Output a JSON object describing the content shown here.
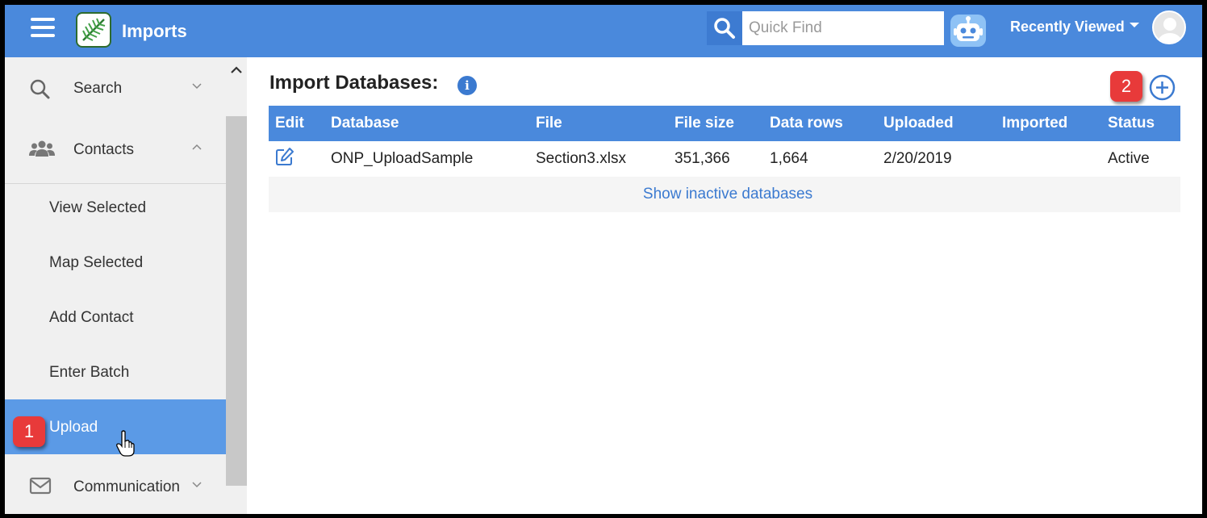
{
  "header": {
    "app_title": "Imports",
    "search_placeholder": "Quick Find",
    "recently_viewed": "Recently Viewed"
  },
  "sidebar": {
    "top_items": [
      {
        "label": "Search",
        "icon": "search-icon"
      },
      {
        "label": "Contacts",
        "icon": "contacts-icon"
      }
    ],
    "sub_items": [
      {
        "label": "View Selected"
      },
      {
        "label": "Map Selected"
      },
      {
        "label": "Add Contact"
      },
      {
        "label": "Enter Batch"
      },
      {
        "label": "Upload",
        "active": true
      }
    ],
    "bottom_item": {
      "label": "Communication",
      "icon": "mail-icon"
    }
  },
  "callouts": {
    "one": "1",
    "two": "2"
  },
  "main": {
    "title": "Import Databases:",
    "info_glyph": "i",
    "table": {
      "headers": [
        "Edit",
        "Database",
        "File",
        "File size",
        "Data rows",
        "Uploaded",
        "Imported",
        "Status"
      ],
      "rows": [
        {
          "database": "ONP_UploadSample",
          "file": "Section3.xlsx",
          "file_size": "351,366",
          "data_rows": "1,664",
          "uploaded": "2/20/2019",
          "imported": "",
          "status": "Active"
        }
      ],
      "show_inactive": "Show inactive databases"
    }
  },
  "colors": {
    "brand_blue": "#4a89dc",
    "active_nav": "#5b9ae6",
    "callout_red": "#e83a3a",
    "link_blue": "#3b7ad0"
  }
}
